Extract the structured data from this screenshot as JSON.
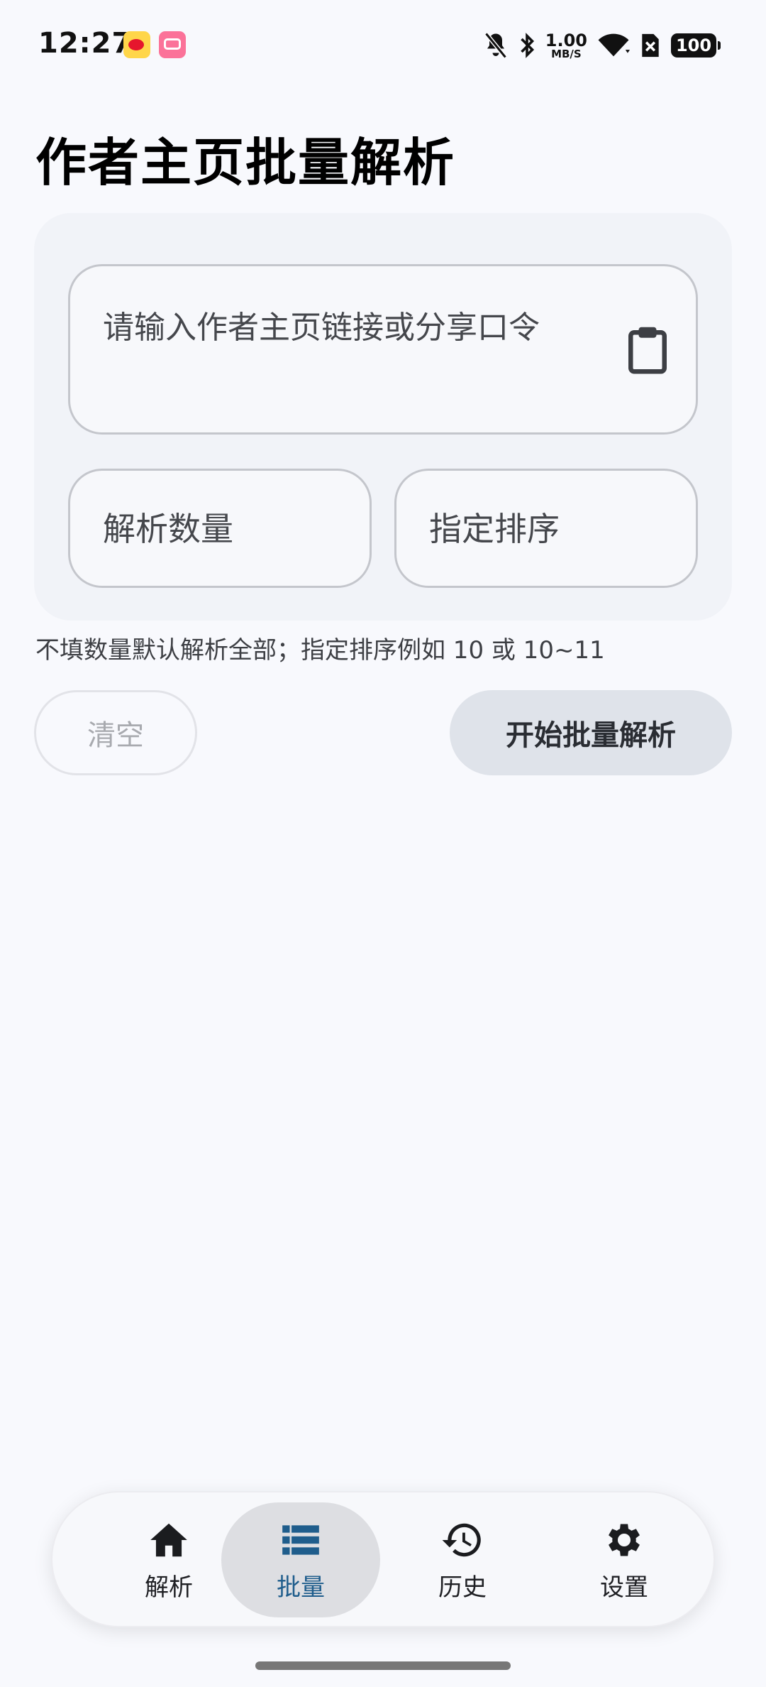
{
  "status_bar": {
    "time": "12:27",
    "net_speed_value": "1.00",
    "net_speed_unit": "MB/S",
    "battery": "100",
    "icons": [
      "weibo-icon",
      "bilibili-icon",
      "mute-icon",
      "bluetooth-icon",
      "wifi-icon",
      "sim-off-icon",
      "battery-icon"
    ]
  },
  "page": {
    "title": "作者主页批量解析",
    "url_placeholder": "请输入作者主页链接或分享口令",
    "count_placeholder": "解析数量",
    "order_placeholder": "指定排序",
    "hint": "不填数量默认解析全部；指定排序例如 10 或 10~11",
    "clear_label": "清空",
    "start_label": "开始批量解析"
  },
  "nav": {
    "items": [
      {
        "label": "解析",
        "icon": "home-icon",
        "active": false
      },
      {
        "label": "批量",
        "icon": "list-icon",
        "active": true
      },
      {
        "label": "历史",
        "icon": "history-icon",
        "active": false
      },
      {
        "label": "设置",
        "icon": "settings-icon",
        "active": false
      }
    ],
    "active_color": "#1f5d8c"
  },
  "colors": {
    "background": "#f8f9fd",
    "card": "#f1f3f8",
    "primary_button": "#dfe3ea"
  }
}
